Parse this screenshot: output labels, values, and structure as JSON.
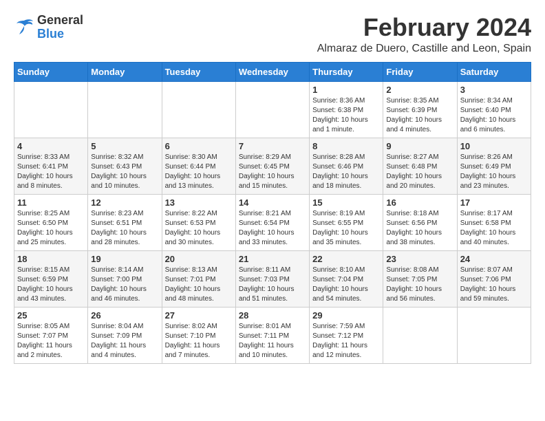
{
  "header": {
    "logo_general": "General",
    "logo_blue": "Blue",
    "month_year": "February 2024",
    "location": "Almaraz de Duero, Castille and Leon, Spain"
  },
  "calendar": {
    "days_of_week": [
      "Sunday",
      "Monday",
      "Tuesday",
      "Wednesday",
      "Thursday",
      "Friday",
      "Saturday"
    ],
    "weeks": [
      [
        {
          "day": "",
          "info": ""
        },
        {
          "day": "",
          "info": ""
        },
        {
          "day": "",
          "info": ""
        },
        {
          "day": "",
          "info": ""
        },
        {
          "day": "1",
          "info": "Sunrise: 8:36 AM\nSunset: 6:38 PM\nDaylight: 10 hours and 1 minute."
        },
        {
          "day": "2",
          "info": "Sunrise: 8:35 AM\nSunset: 6:39 PM\nDaylight: 10 hours and 4 minutes."
        },
        {
          "day": "3",
          "info": "Sunrise: 8:34 AM\nSunset: 6:40 PM\nDaylight: 10 hours and 6 minutes."
        }
      ],
      [
        {
          "day": "4",
          "info": "Sunrise: 8:33 AM\nSunset: 6:41 PM\nDaylight: 10 hours and 8 minutes."
        },
        {
          "day": "5",
          "info": "Sunrise: 8:32 AM\nSunset: 6:43 PM\nDaylight: 10 hours and 10 minutes."
        },
        {
          "day": "6",
          "info": "Sunrise: 8:30 AM\nSunset: 6:44 PM\nDaylight: 10 hours and 13 minutes."
        },
        {
          "day": "7",
          "info": "Sunrise: 8:29 AM\nSunset: 6:45 PM\nDaylight: 10 hours and 15 minutes."
        },
        {
          "day": "8",
          "info": "Sunrise: 8:28 AM\nSunset: 6:46 PM\nDaylight: 10 hours and 18 minutes."
        },
        {
          "day": "9",
          "info": "Sunrise: 8:27 AM\nSunset: 6:48 PM\nDaylight: 10 hours and 20 minutes."
        },
        {
          "day": "10",
          "info": "Sunrise: 8:26 AM\nSunset: 6:49 PM\nDaylight: 10 hours and 23 minutes."
        }
      ],
      [
        {
          "day": "11",
          "info": "Sunrise: 8:25 AM\nSunset: 6:50 PM\nDaylight: 10 hours and 25 minutes."
        },
        {
          "day": "12",
          "info": "Sunrise: 8:23 AM\nSunset: 6:51 PM\nDaylight: 10 hours and 28 minutes."
        },
        {
          "day": "13",
          "info": "Sunrise: 8:22 AM\nSunset: 6:53 PM\nDaylight: 10 hours and 30 minutes."
        },
        {
          "day": "14",
          "info": "Sunrise: 8:21 AM\nSunset: 6:54 PM\nDaylight: 10 hours and 33 minutes."
        },
        {
          "day": "15",
          "info": "Sunrise: 8:19 AM\nSunset: 6:55 PM\nDaylight: 10 hours and 35 minutes."
        },
        {
          "day": "16",
          "info": "Sunrise: 8:18 AM\nSunset: 6:56 PM\nDaylight: 10 hours and 38 minutes."
        },
        {
          "day": "17",
          "info": "Sunrise: 8:17 AM\nSunset: 6:58 PM\nDaylight: 10 hours and 40 minutes."
        }
      ],
      [
        {
          "day": "18",
          "info": "Sunrise: 8:15 AM\nSunset: 6:59 PM\nDaylight: 10 hours and 43 minutes."
        },
        {
          "day": "19",
          "info": "Sunrise: 8:14 AM\nSunset: 7:00 PM\nDaylight: 10 hours and 46 minutes."
        },
        {
          "day": "20",
          "info": "Sunrise: 8:13 AM\nSunset: 7:01 PM\nDaylight: 10 hours and 48 minutes."
        },
        {
          "day": "21",
          "info": "Sunrise: 8:11 AM\nSunset: 7:03 PM\nDaylight: 10 hours and 51 minutes."
        },
        {
          "day": "22",
          "info": "Sunrise: 8:10 AM\nSunset: 7:04 PM\nDaylight: 10 hours and 54 minutes."
        },
        {
          "day": "23",
          "info": "Sunrise: 8:08 AM\nSunset: 7:05 PM\nDaylight: 10 hours and 56 minutes."
        },
        {
          "day": "24",
          "info": "Sunrise: 8:07 AM\nSunset: 7:06 PM\nDaylight: 10 hours and 59 minutes."
        }
      ],
      [
        {
          "day": "25",
          "info": "Sunrise: 8:05 AM\nSunset: 7:07 PM\nDaylight: 11 hours and 2 minutes."
        },
        {
          "day": "26",
          "info": "Sunrise: 8:04 AM\nSunset: 7:09 PM\nDaylight: 11 hours and 4 minutes."
        },
        {
          "day": "27",
          "info": "Sunrise: 8:02 AM\nSunset: 7:10 PM\nDaylight: 11 hours and 7 minutes."
        },
        {
          "day": "28",
          "info": "Sunrise: 8:01 AM\nSunset: 7:11 PM\nDaylight: 11 hours and 10 minutes."
        },
        {
          "day": "29",
          "info": "Sunrise: 7:59 AM\nSunset: 7:12 PM\nDaylight: 11 hours and 12 minutes."
        },
        {
          "day": "",
          "info": ""
        },
        {
          "day": "",
          "info": ""
        }
      ]
    ]
  }
}
